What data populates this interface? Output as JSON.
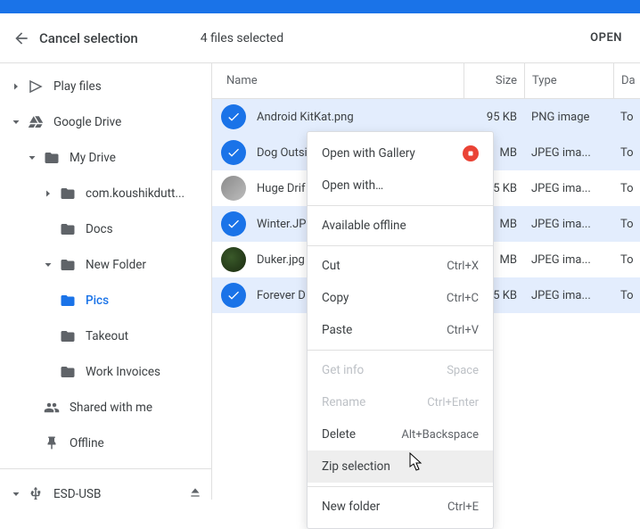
{
  "toolbar": {
    "cancel_label": "Cancel selection",
    "selection_label": "4 files selected",
    "open_label": "OPEN"
  },
  "columns": {
    "name": "Name",
    "size": "Size",
    "type": "Type",
    "date": "Da"
  },
  "tree": {
    "play_files": "Play files",
    "google_drive": "Google Drive",
    "my_drive": "My Drive",
    "com_koushik": "com.koushikdutt...",
    "docs": "Docs",
    "new_folder": "New Folder",
    "pics": "Pics",
    "takeout": "Takeout",
    "work_invoices": "Work Invoices",
    "shared": "Shared with me",
    "offline": "Offline",
    "esd_usb": "ESD-USB"
  },
  "files": [
    {
      "name": "Android KitKat.png",
      "size": "95 KB",
      "type": "PNG image",
      "date": "To",
      "selected": true,
      "check": true
    },
    {
      "name": "Dog Outsi",
      "size": "MB",
      "type": "JPEG ima...",
      "date": "To",
      "selected": true,
      "check": true
    },
    {
      "name": "Huge Drif",
      "size": "5 KB",
      "type": "JPEG ima...",
      "date": "To",
      "selected": false,
      "check": false,
      "thumb": "gray"
    },
    {
      "name": "Winter.JP",
      "size": "MB",
      "type": "JPEG ima...",
      "date": "To",
      "selected": true,
      "check": true
    },
    {
      "name": "Duker.jpg",
      "size": "MB",
      "type": "JPEG ima...",
      "date": "To",
      "selected": false,
      "check": false,
      "thumb": "green"
    },
    {
      "name": "Forever D",
      "size": "5 KB",
      "type": "JPEG ima...",
      "date": "To",
      "selected": true,
      "check": true
    }
  ],
  "menu": {
    "open_gallery": "Open with Gallery",
    "open_with": "Open with…",
    "available_offline": "Available offline",
    "cut": "Cut",
    "copy": "Copy",
    "paste": "Paste",
    "get_info": "Get info",
    "rename": "Rename",
    "delete": "Delete",
    "zip": "Zip selection",
    "new_folder": "New folder",
    "sc_cut": "Ctrl+X",
    "sc_copy": "Ctrl+C",
    "sc_paste": "Ctrl+V",
    "sc_info": "Space",
    "sc_rename": "Ctrl+Enter",
    "sc_delete": "Alt+Backspace",
    "sc_newfolder": "Ctrl+E"
  }
}
